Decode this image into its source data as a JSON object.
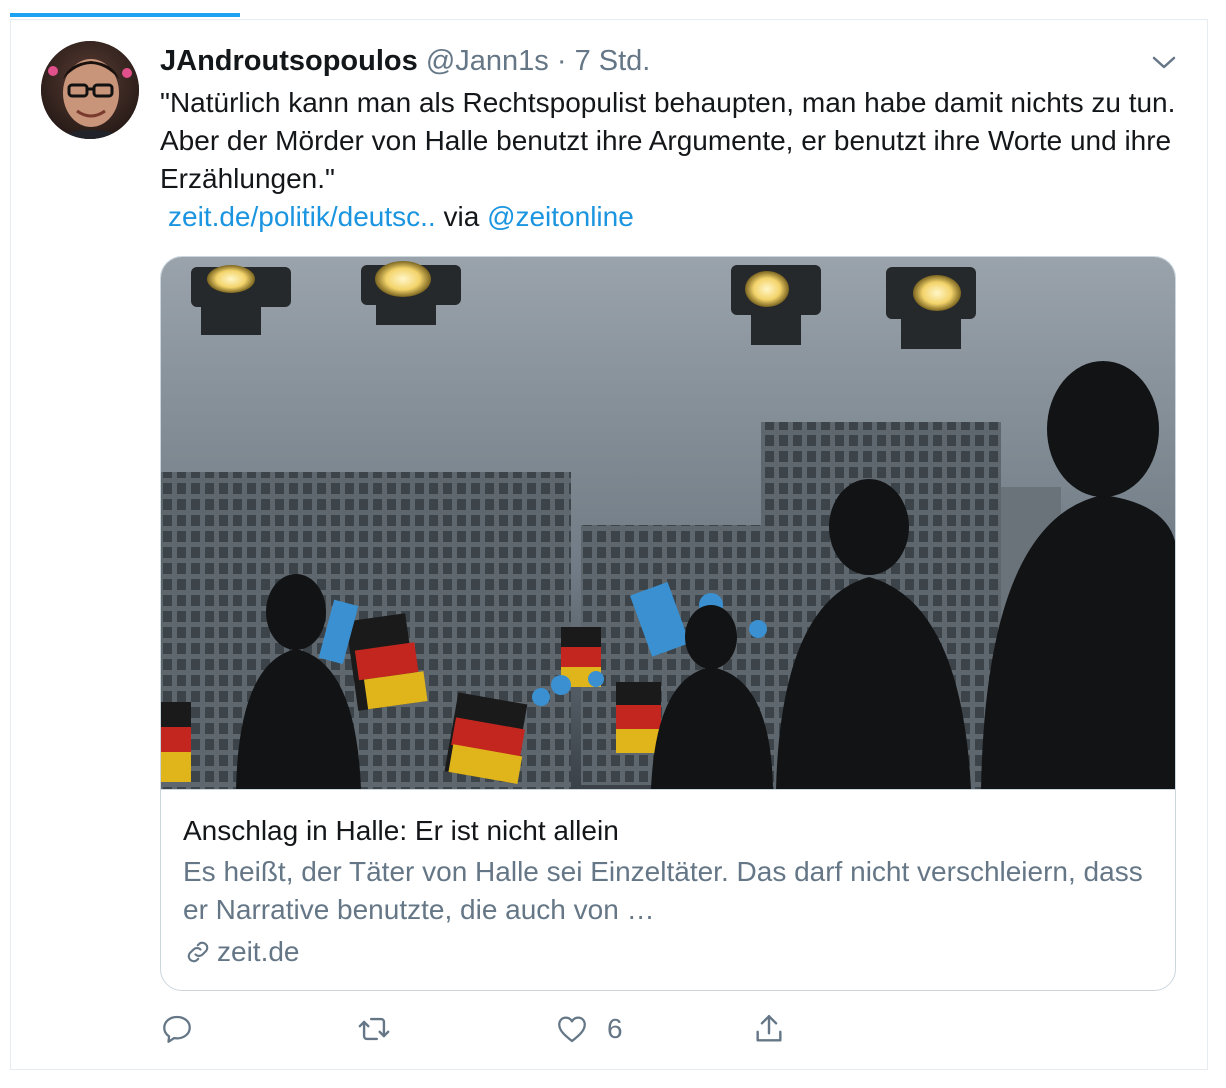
{
  "tweet": {
    "display_name": "JAndroutsopoulos",
    "handle": "@Jann1s",
    "separator": "·",
    "time": "7 Std.",
    "text": "\"Natürlich kann man als Rechtspopulist behaupten, man habe damit nichts zu tun. Aber der Mörder von Halle benutzt ihre Argumente, er benutzt ihre Worte und ihre Erzählungen.\"",
    "link_text": "zeit.de/politik/deutsc..",
    "via_text": "via",
    "mention": "@zeitonline",
    "like_count": "6"
  },
  "card": {
    "title": "Anschlag in Halle: Er ist nicht allein",
    "description": "Es heißt, der Täter von Halle sei Einzeltäter. Das darf nicht verschleiern, dass er Narrative benutzte, die auch von …",
    "domain": "zeit.de"
  },
  "icons": {
    "caret": "chevron-down-icon",
    "reply": "reply-icon",
    "retweet": "retweet-icon",
    "like": "heart-icon",
    "share": "share-icon",
    "link": "link-icon"
  },
  "colors": {
    "accent": "#1da1f2",
    "link": "#1b95e0",
    "secondary_text": "#657786",
    "border": "#ccd6dd"
  }
}
